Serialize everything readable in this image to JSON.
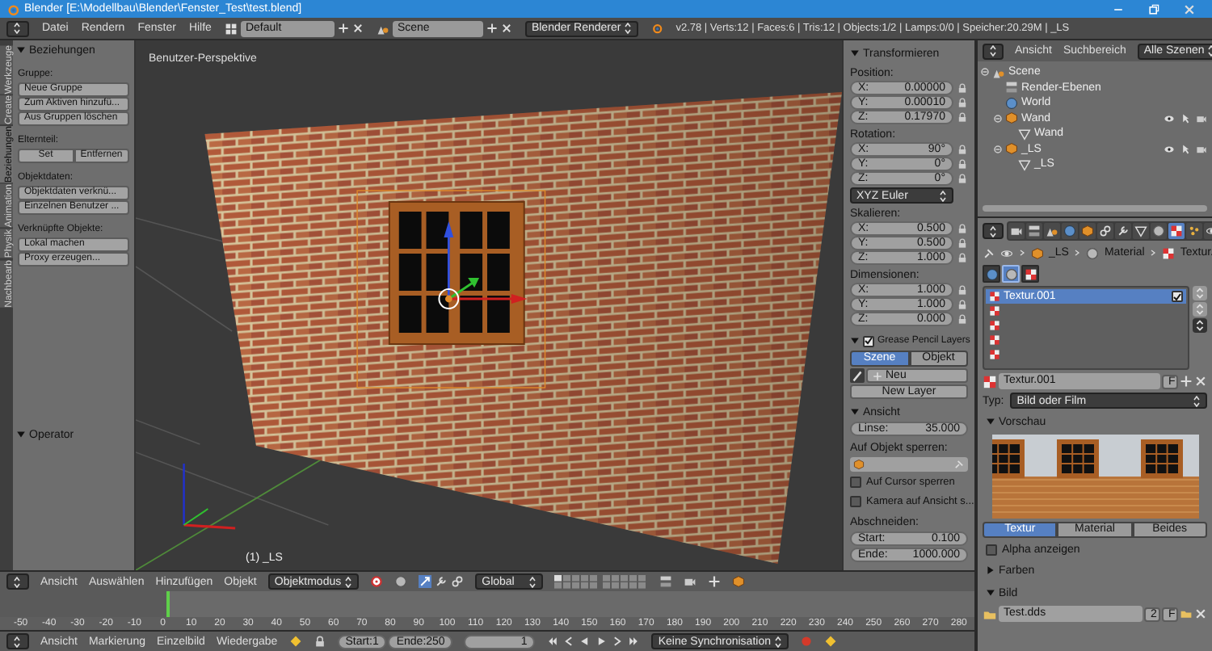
{
  "window": {
    "title": "Blender [E:\\Modellbau\\Blender\\Fenster_Test\\test.blend]"
  },
  "menu": [
    "Datei",
    "Rendern",
    "Fenster",
    "Hilfe"
  ],
  "layout": "Default",
  "scene": "Scene",
  "renderer": "Blender Renderer",
  "stats": "v2.78 | Verts:12 | Faces:6 | Tris:12 | Objects:1/2 | Lamps:0/0 | Speicher:20.29M | _LS",
  "vertical_tabs": [
    {
      "label": "Werkzeuge",
      "selected": false
    },
    {
      "label": "Create",
      "selected": false
    },
    {
      "label": "Beziehungen",
      "selected": true
    },
    {
      "label": "Animation",
      "selected": false
    },
    {
      "label": "Physik",
      "selected": false
    },
    {
      "label": "Nachbearb",
      "selected": false
    }
  ],
  "tool_shelf": {
    "title": "Beziehungen",
    "expanded": true,
    "groups": [
      {
        "label": "Gruppe:",
        "kind": "stack",
        "buttons": [
          "Neue Gruppe",
          "Zum Aktiven hinzufü...",
          "Aus Gruppen löschen"
        ]
      },
      {
        "label": "Elternteil:",
        "kind": "row",
        "buttons": [
          "Set",
          "Entfernen"
        ]
      },
      {
        "label": "Objektdaten:",
        "kind": "stack",
        "buttons": [
          "Objektdaten verknü...",
          "Einzelnen Benutzer ..."
        ]
      },
      {
        "label": "Verknüpfte Objekte:",
        "kind": "stack",
        "buttons": [
          "Lokal machen",
          "Proxy erzeugen..."
        ]
      }
    ],
    "operator": {
      "title": "Operator",
      "expanded": true
    }
  },
  "viewport": {
    "title": "Benutzer-Perspektive",
    "object_label": "(1) _LS"
  },
  "n_panel": {
    "title": "Transformieren",
    "expanded": true,
    "sections": [
      {
        "label": "Position:",
        "fields": [
          {
            "axis": "X:",
            "value": "0.00000"
          },
          {
            "axis": "Y:",
            "value": "0.00010"
          },
          {
            "axis": "Z:",
            "value": "0.17970"
          }
        ]
      },
      {
        "label": "Rotation:",
        "fields": [
          {
            "axis": "X:",
            "value": "90°"
          },
          {
            "axis": "Y:",
            "value": "0°"
          },
          {
            "axis": "Z:",
            "value": "0°"
          }
        ],
        "mode": "XYZ Euler"
      },
      {
        "label": "Skalieren:",
        "fields": [
          {
            "axis": "X:",
            "value": "0.500"
          },
          {
            "axis": "Y:",
            "value": "0.500"
          },
          {
            "axis": "Z:",
            "value": "1.000"
          }
        ]
      },
      {
        "label": "Dimensionen:",
        "fields": [
          {
            "axis": "X:",
            "value": "1.000"
          },
          {
            "axis": "Y:",
            "value": "1.000"
          },
          {
            "axis": "Z:",
            "value": "0.000"
          }
        ]
      }
    ],
    "grease_pencil": {
      "title": "Grease Pencil Layers",
      "expanded": true,
      "checked": true,
      "tabs": [
        {
          "label": "Szene",
          "selected": true
        },
        {
          "label": "Objekt",
          "selected": false
        }
      ],
      "new": "Neu",
      "new_layer": "New Layer"
    },
    "view": {
      "title": "Ansicht",
      "expanded": true,
      "lens": {
        "label": "Linse:",
        "value": "35.000"
      },
      "lock_label": "Auf Objekt sperren:",
      "checkboxes": [
        {
          "label": "Auf Cursor sperren",
          "checked": false
        },
        {
          "label": "Kamera auf Ansicht s...",
          "checked": false
        }
      ],
      "clip_label": "Abschneiden:",
      "clip": [
        {
          "label": "Start:",
          "value": "0.100"
        },
        {
          "label": "Ende:",
          "value": "1000.000"
        }
      ]
    }
  },
  "outliner": {
    "menus": [
      "Ansicht",
      "Suchbereich"
    ],
    "filter": "Alle Szenen",
    "tree": [
      {
        "label": "Scene",
        "kind": "scene",
        "children": [
          {
            "label": "Render-Ebenen",
            "kind": "render_layers"
          },
          {
            "label": "World",
            "kind": "world"
          },
          {
            "label": "Wand",
            "kind": "object",
            "children": [
              {
                "label": "Wand",
                "kind": "mesh"
              }
            ]
          },
          {
            "label": "_LS",
            "kind": "object",
            "children": [
              {
                "label": "_LS",
                "kind": "mesh"
              }
            ]
          }
        ]
      }
    ]
  },
  "properties": {
    "tabs": [
      {
        "kind": "render",
        "selected": false
      },
      {
        "kind": "layers",
        "selected": false
      },
      {
        "kind": "scene",
        "selected": false
      },
      {
        "kind": "world",
        "selected": false
      },
      {
        "kind": "object",
        "selected": false
      },
      {
        "kind": "constraints",
        "selected": false
      },
      {
        "kind": "modifiers",
        "selected": false
      },
      {
        "kind": "data",
        "selected": false
      },
      {
        "kind": "material",
        "selected": false
      },
      {
        "kind": "texture",
        "selected": true
      },
      {
        "kind": "particles",
        "selected": false
      },
      {
        "kind": "physics",
        "selected": false
      }
    ],
    "breadcrumb": [
      "_LS",
      "Material",
      "Textur."
    ],
    "context_tabs": [
      {
        "kind": "world",
        "selected": false
      },
      {
        "kind": "material",
        "selected": true
      },
      {
        "kind": "texture",
        "selected": false
      }
    ],
    "slots": [
      {
        "name": "Textur.001",
        "selected": true,
        "checked": true
      },
      {
        "selected": false
      },
      {
        "selected": false
      },
      {
        "selected": false
      },
      {
        "selected": false
      }
    ],
    "texture_name": "Textur.001",
    "fake_user": "F",
    "type_label": "Typ:",
    "type": "Bild oder Film",
    "preview": {
      "title": "Vorschau",
      "expanded": true,
      "tabs": [
        {
          "label": "Textur",
          "selected": true
        },
        {
          "label": "Material",
          "selected": false
        },
        {
          "label": "Beides",
          "selected": false
        }
      ],
      "alpha": {
        "label": "Alpha anzeigen",
        "checked": false
      }
    },
    "colors": {
      "title": "Farben",
      "expanded": false
    },
    "image": {
      "title": "Bild",
      "expanded": true,
      "name": "Test.dds",
      "users": "2",
      "fake_user": "F"
    }
  },
  "view3d_header": {
    "menus": [
      "Ansicht",
      "Auswählen",
      "Hinzufügen",
      "Objekt"
    ],
    "mode": "Objektmodus",
    "orientation": "Global"
  },
  "timeline": {
    "ticks": [
      "-50",
      "-40",
      "-30",
      "-20",
      "-10",
      "0",
      "10",
      "20",
      "30",
      "40",
      "50",
      "60",
      "70",
      "80",
      "90",
      "100",
      "110",
      "120",
      "130",
      "140",
      "150",
      "160",
      "170",
      "180",
      "190",
      "200",
      "210",
      "220",
      "230",
      "240",
      "250",
      "260",
      "270",
      "280"
    ],
    "playhead": {
      "level": 0.155
    },
    "menus": [
      "Ansicht",
      "Markierung",
      "Einzelbild",
      "Wiedergabe"
    ],
    "start": {
      "label": "Start:",
      "value": "1"
    },
    "end": {
      "label": "Ende:",
      "value": "250"
    },
    "current": "1",
    "sync": "Keine Synchronisation"
  }
}
